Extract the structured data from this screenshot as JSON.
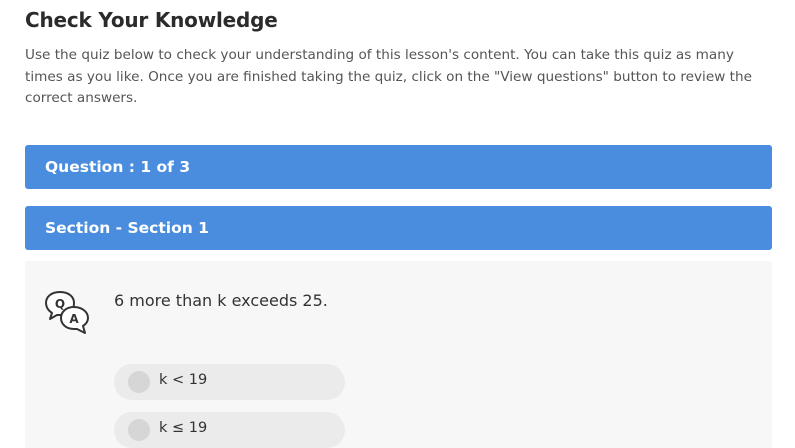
{
  "page": {
    "title": "Check Your Knowledge",
    "intro": "Use the quiz below to check your understanding of this lesson's content. You can take this quiz as many times as you like. Once you are finished taking the quiz, click on the \"View questions\" button to review the correct answers."
  },
  "quiz": {
    "question_header": "Question : 1 of 3",
    "section_header": "Section - Section 1",
    "question_text": "6 more than k exceeds 25.",
    "icon": "qa-speech-bubbles-icon",
    "options": [
      {
        "label": "k < 19"
      },
      {
        "label": "k ≤ 19"
      }
    ]
  },
  "colors": {
    "accent": "#4a8ddf",
    "panel_bg": "#f7f7f7",
    "option_bg": "#ebebeb",
    "radio": "#d6d6d6"
  }
}
